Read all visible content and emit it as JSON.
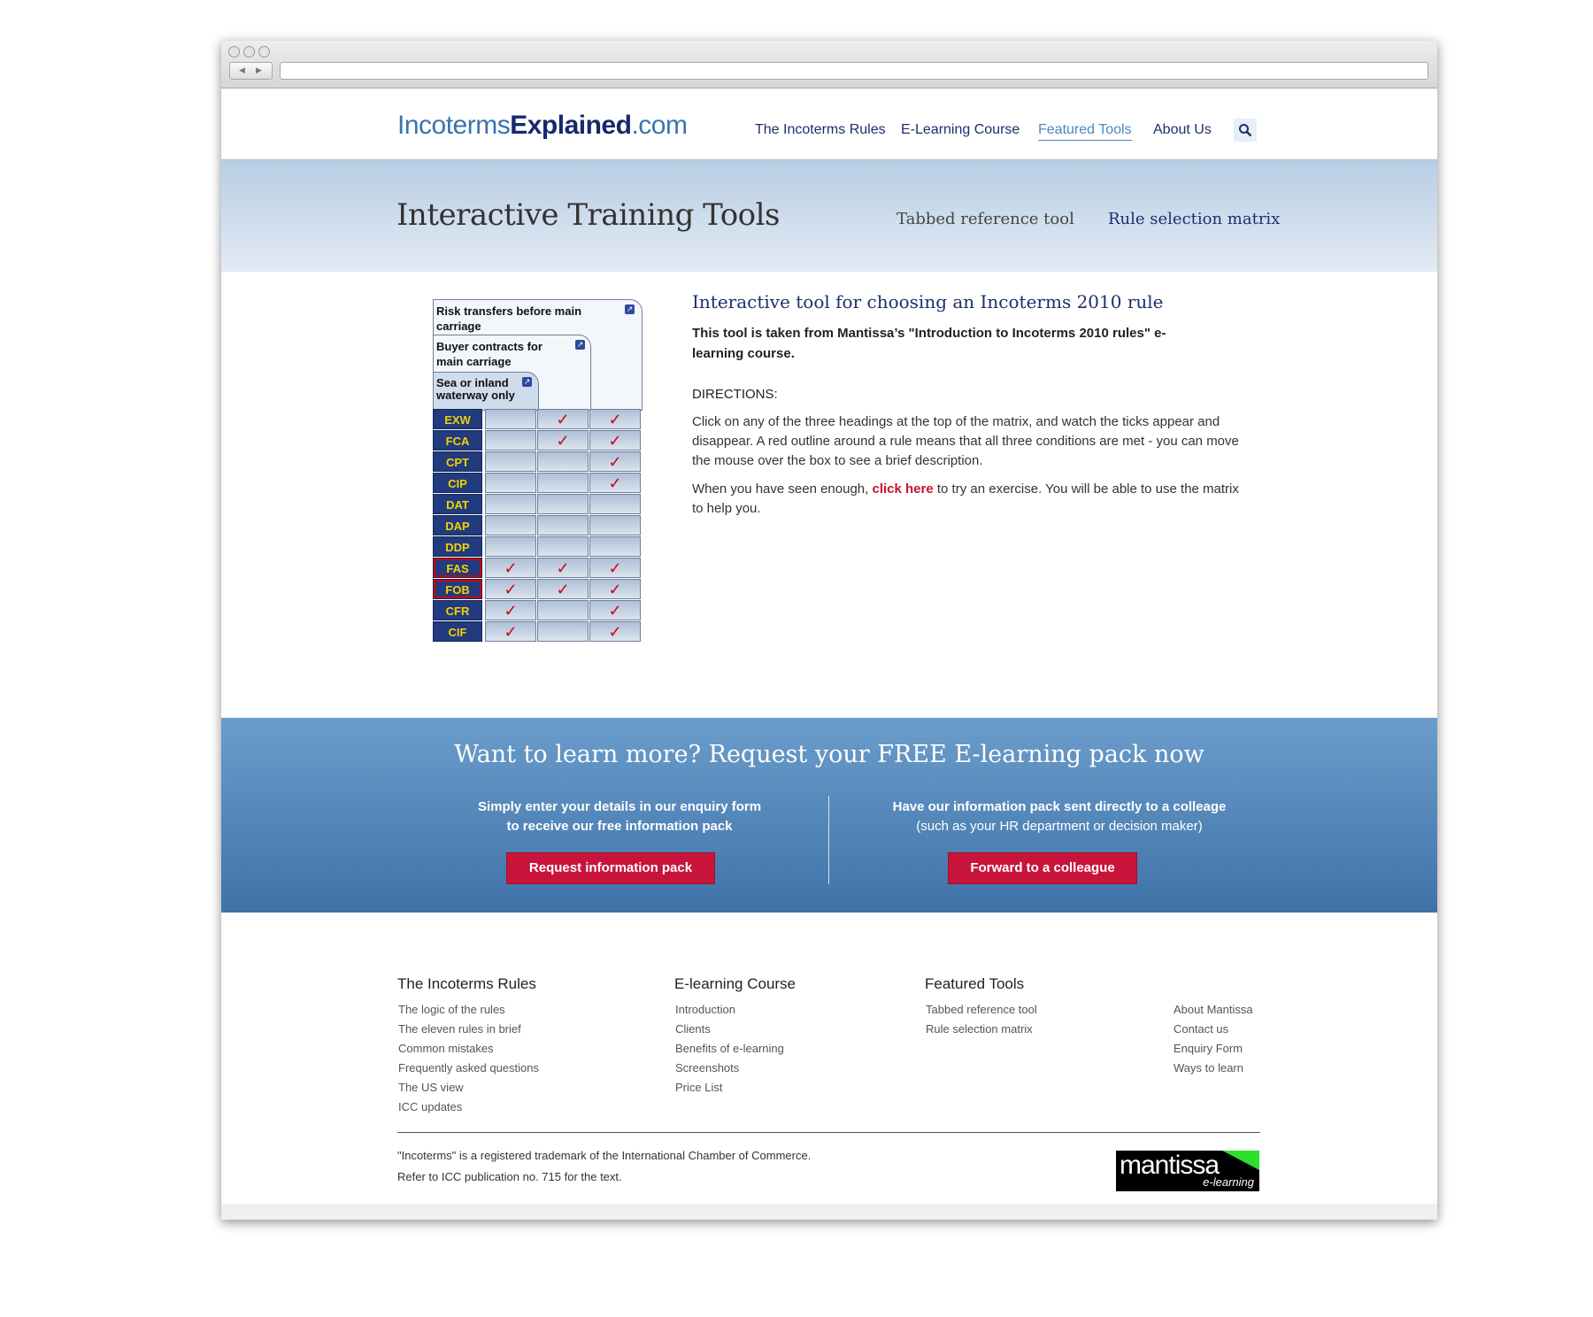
{
  "header": {
    "logo": {
      "part1": "Incoterms",
      "part2": "Explained",
      "part3": ".com"
    },
    "nav": [
      "The Incoterms Rules",
      "E-Learning Course",
      "Featured Tools",
      "About Us"
    ],
    "active_nav": "Featured Tools",
    "search_icon": "search-icon"
  },
  "hero": {
    "title": "Interactive Training Tools",
    "tab1": "Tabbed reference tool",
    "tab2": "Rule selection matrix"
  },
  "matrix": {
    "head1": "Risk transfers before main carriage",
    "head2": "Buyer contracts for main carriage",
    "head3": "Sea or inland waterway only",
    "rows": [
      {
        "code": "EXW",
        "c1": "",
        "c2": "✓",
        "c3": "✓",
        "sel": false
      },
      {
        "code": "FCA",
        "c1": "",
        "c2": "✓",
        "c3": "✓",
        "sel": false
      },
      {
        "code": "CPT",
        "c1": "",
        "c2": "",
        "c3": "✓",
        "sel": false
      },
      {
        "code": "CIP",
        "c1": "",
        "c2": "",
        "c3": "✓",
        "sel": false
      },
      {
        "code": "DAT",
        "c1": "",
        "c2": "",
        "c3": "",
        "sel": false
      },
      {
        "code": "DAP",
        "c1": "",
        "c2": "",
        "c3": "",
        "sel": false
      },
      {
        "code": "DDP",
        "c1": "",
        "c2": "",
        "c3": "",
        "sel": false
      },
      {
        "code": "FAS",
        "c1": "✓",
        "c2": "✓",
        "c3": "✓",
        "sel": true
      },
      {
        "code": "FOB",
        "c1": "✓",
        "c2": "✓",
        "c3": "✓",
        "sel": true
      },
      {
        "code": "CFR",
        "c1": "✓",
        "c2": "",
        "c3": "✓",
        "sel": false
      },
      {
        "code": "CIF",
        "c1": "✓",
        "c2": "",
        "c3": "✓",
        "sel": false
      }
    ]
  },
  "intro": {
    "title": "Interactive tool for choosing an Incoterms 2010 rule",
    "lead": "This tool is taken from Mantissa’s \"Introduction to Incoterms 2010 rules\" e-learning course.",
    "directions": "DIRECTIONS:",
    "p1": "Click on any of the three headings at the top of the matrix, and watch the ticks appear and disappear. A red outline around a rule means that all three conditions are met - you can move the mouse over the box to see a brief description.",
    "p2_before": "When you have seen enough, ",
    "p2_link": "click here",
    "p2_after": " to try an exercise. You will be able to use the matrix to help you."
  },
  "band": {
    "title": "Want to learn more? Request your FREE E-learning pack now",
    "left_line1": "Simply enter your details in our enquiry form",
    "left_line2": "to receive our free information pack",
    "right_line1": "Have our information pack sent directly to a colleage",
    "right_line2": "(such as your HR department or decision maker)",
    "btn_left": "Request information pack",
    "btn_right": "Forward to a colleague"
  },
  "footer": {
    "col1_title": "The Incoterms Rules",
    "col1": [
      "The logic of the rules",
      "The eleven rules in brief",
      "Common mistakes",
      "Frequently asked questions",
      "The US view",
      "ICC updates"
    ],
    "col2_title": "E-learning Course",
    "col2": [
      "Introduction",
      "Clients",
      "Benefits of e-learning",
      "Screenshots",
      "Price List"
    ],
    "col3_title": "Featured Tools",
    "col3": [
      "Tabbed reference tool",
      "Rule selection matrix"
    ],
    "col4": [
      "About Mantissa",
      "Contact us",
      "Enquiry Form",
      "Ways to learn"
    ],
    "legal1": "\"Incoterms\" is a registered trademark of the International Chamber of Commerce.",
    "legal2": "Refer to ICC publication no. 715 for the text.",
    "logo_word": "mantissa",
    "logo_sub": "e-learning"
  }
}
